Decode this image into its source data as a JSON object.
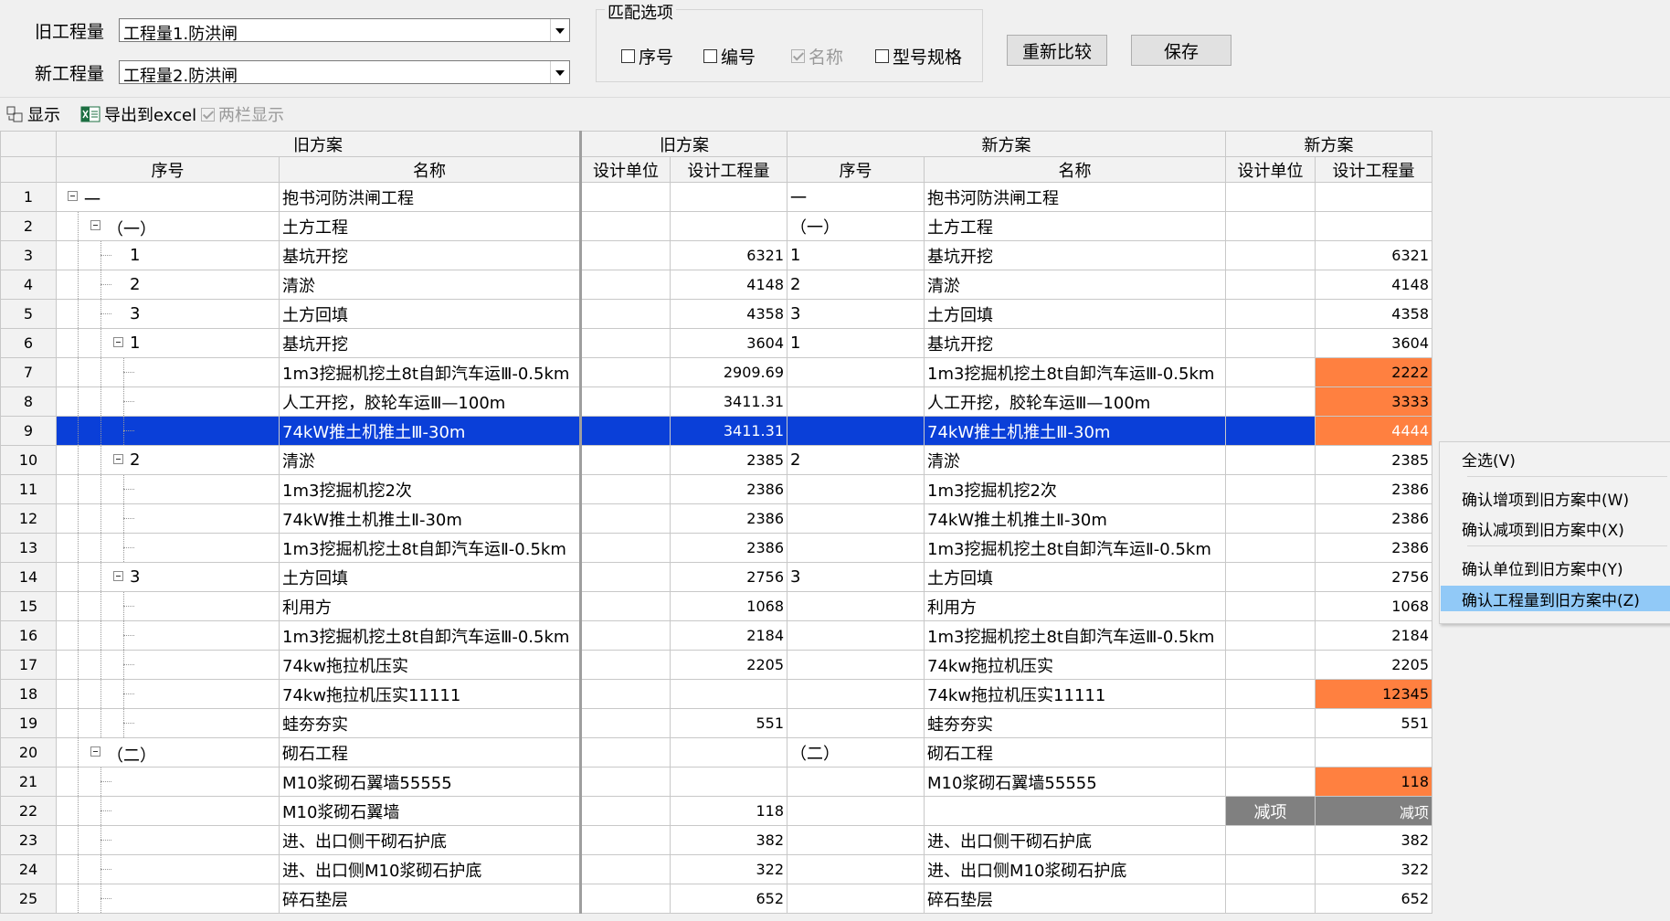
{
  "header": {
    "old_label": "旧工程量",
    "old_value": "工程量1.防洪闸",
    "new_label": "新工程量",
    "new_value": "工程量2.防洪闸",
    "match_title": "匹配选项",
    "opt_seq": "序号",
    "opt_code": "编号",
    "opt_name": "名称",
    "opt_spec": "型号规格",
    "btn_compare": "重新比较",
    "btn_save": "保存"
  },
  "toolbar": {
    "show": "显示",
    "export": "导出到excel",
    "two_col": "两栏显示"
  },
  "grid": {
    "groups": {
      "old": "旧方案",
      "old2": "旧方案",
      "new": "新方案",
      "new2": "新方案"
    },
    "cols": {
      "seq": "序号",
      "name": "名称",
      "unit": "设计单位",
      "qty": "设计工程量",
      "nseq": "序号",
      "nname": "名称",
      "nunit": "设计单位",
      "nqty": "设计工程量"
    },
    "rows": [
      {
        "n": "1",
        "seq": "一",
        "name": "抱书河防洪闸工程",
        "qty": "",
        "nseq": "一",
        "nname": "抱书河防洪闸工程",
        "nunit": "",
        "nqty": ""
      },
      {
        "n": "2",
        "seq": "（一）",
        "name": "土方工程",
        "qty": "",
        "nseq": "（一）",
        "nname": "土方工程",
        "nunit": "",
        "nqty": ""
      },
      {
        "n": "3",
        "seq": "1",
        "name": "基坑开挖",
        "qty": "6321",
        "nseq": "1",
        "nname": "基坑开挖",
        "nunit": "",
        "nqty": "6321"
      },
      {
        "n": "4",
        "seq": "2",
        "name": "清淤",
        "qty": "4148",
        "nseq": "2",
        "nname": "清淤",
        "nunit": "",
        "nqty": "4148"
      },
      {
        "n": "5",
        "seq": "3",
        "name": "土方回填",
        "qty": "4358",
        "nseq": "3",
        "nname": "土方回填",
        "nunit": "",
        "nqty": "4358"
      },
      {
        "n": "6",
        "seq": "1",
        "name": "基坑开挖",
        "qty": "3604",
        "nseq": "1",
        "nname": "基坑开挖",
        "nunit": "",
        "nqty": "3604"
      },
      {
        "n": "7",
        "seq": "",
        "name": "1m3挖掘机挖土8t自卸汽车运Ⅲ-0.5km",
        "qty": "2909.69",
        "nseq": "",
        "nname": "1m3挖掘机挖土8t自卸汽车运Ⅲ-0.5km",
        "nunit": "",
        "nqty": "2222"
      },
      {
        "n": "8",
        "seq": "",
        "name": "人工开挖，胶轮车运Ⅲ—100m",
        "qty": "3411.31",
        "nseq": "",
        "nname": "人工开挖，胶轮车运Ⅲ—100m",
        "nunit": "",
        "nqty": "3333"
      },
      {
        "n": "9",
        "seq": "",
        "name": "74kW推土机推土Ⅲ-30m",
        "qty": "3411.31",
        "nseq": "",
        "nname": "74kW推土机推土Ⅲ-30m",
        "nunit": "",
        "nqty": "4444"
      },
      {
        "n": "10",
        "seq": "2",
        "name": "清淤",
        "qty": "2385",
        "nseq": "2",
        "nname": "清淤",
        "nunit": "",
        "nqty": "2385"
      },
      {
        "n": "11",
        "seq": "",
        "name": "1m3挖掘机挖2次",
        "qty": "2386",
        "nseq": "",
        "nname": "1m3挖掘机挖2次",
        "nunit": "",
        "nqty": "2386"
      },
      {
        "n": "12",
        "seq": "",
        "name": "74kW推土机推土Ⅱ-30m",
        "qty": "2386",
        "nseq": "",
        "nname": "74kW推土机推土Ⅱ-30m",
        "nunit": "",
        "nqty": "2386"
      },
      {
        "n": "13",
        "seq": "",
        "name": "1m3挖掘机挖土8t自卸汽车运Ⅱ-0.5km",
        "qty": "2386",
        "nseq": "",
        "nname": "1m3挖掘机挖土8t自卸汽车运Ⅱ-0.5km",
        "nunit": "",
        "nqty": "2386"
      },
      {
        "n": "14",
        "seq": "3",
        "name": "土方回填",
        "qty": "2756",
        "nseq": "3",
        "nname": "土方回填",
        "nunit": "",
        "nqty": "2756"
      },
      {
        "n": "15",
        "seq": "",
        "name": "利用方",
        "qty": "1068",
        "nseq": "",
        "nname": "利用方",
        "nunit": "",
        "nqty": "1068"
      },
      {
        "n": "16",
        "seq": "",
        "name": "1m3挖掘机挖土8t自卸汽车运Ⅲ-0.5km",
        "qty": "2184",
        "nseq": "",
        "nname": "1m3挖掘机挖土8t自卸汽车运Ⅲ-0.5km",
        "nunit": "",
        "nqty": "2184"
      },
      {
        "n": "17",
        "seq": "",
        "name": "74kw拖拉机压实",
        "qty": "2205",
        "nseq": "",
        "nname": "74kw拖拉机压实",
        "nunit": "",
        "nqty": "2205"
      },
      {
        "n": "18",
        "seq": "",
        "name": "74kw拖拉机压实11111",
        "qty": "",
        "nseq": "",
        "nname": "74kw拖拉机压实11111",
        "nunit": "",
        "nqty": "12345"
      },
      {
        "n": "19",
        "seq": "",
        "name": "蛙夯夯实",
        "qty": "551",
        "nseq": "",
        "nname": "蛙夯夯实",
        "nunit": "",
        "nqty": "551"
      },
      {
        "n": "20",
        "seq": "（二）",
        "name": "砌石工程",
        "qty": "",
        "nseq": "（二）",
        "nname": "砌石工程",
        "nunit": "",
        "nqty": ""
      },
      {
        "n": "21",
        "seq": "",
        "name": "M10浆砌石翼墙55555",
        "qty": "",
        "nseq": "",
        "nname": "M10浆砌石翼墙55555",
        "nunit": "",
        "nqty": "118"
      },
      {
        "n": "22",
        "seq": "",
        "name": "M10浆砌石翼墙",
        "qty": "118",
        "nseq": "",
        "nname": "",
        "nunit": "减项",
        "nqty": "减项"
      },
      {
        "n": "23",
        "seq": "",
        "name": "进、出口侧干砌石护底",
        "qty": "382",
        "nseq": "",
        "nname": "进、出口侧干砌石护底",
        "nunit": "",
        "nqty": "382"
      },
      {
        "n": "24",
        "seq": "",
        "name": "进、出口侧M10浆砌石护底",
        "qty": "322",
        "nseq": "",
        "nname": "进、出口侧M10浆砌石护底",
        "nunit": "",
        "nqty": "322"
      },
      {
        "n": "25",
        "seq": "",
        "name": "碎石垫层",
        "qty": "652",
        "nseq": "",
        "nname": "碎石垫层",
        "nunit": "",
        "nqty": "652"
      }
    ]
  },
  "context_menu": {
    "select_all": "全选(V)",
    "confirm_add": "确认增项到旧方案中(W)",
    "confirm_remove": "确认减项到旧方案中(X)",
    "confirm_unit": "确认单位到旧方案中(Y)",
    "confirm_qty": "确认工程量到旧方案中(Z)"
  },
  "colors": {
    "selection": "#0a3fd8",
    "diff": "#ff8040",
    "removed": "#808080",
    "menu_highlight": "#91c9f7"
  }
}
